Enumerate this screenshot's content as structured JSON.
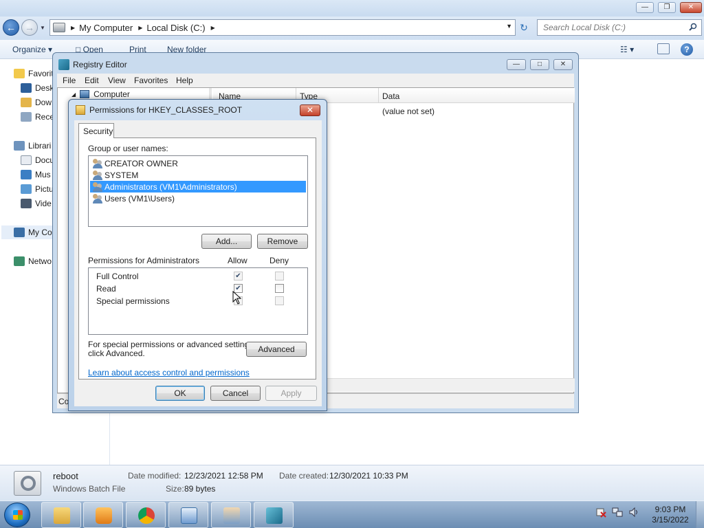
{
  "explorer": {
    "address": [
      "My Computer",
      "Local Disk (C:)"
    ],
    "search_placeholder": "Search Local Disk (C:)",
    "toolbar": {
      "organize": "Organize",
      "open": "Open",
      "print": "Print",
      "new_folder": "New folder"
    },
    "nav": {
      "favorites": "Favorit",
      "desktop": "Desk",
      "downloads": "Dow",
      "recent": "Rece",
      "libraries": "Librari",
      "documents": "Docu",
      "music": "Mus",
      "pictures": "Pictu",
      "videos": "Vide",
      "my_computer": "My Co",
      "network": "Netwo"
    },
    "details": {
      "name": "reboot",
      "type": "Windows Batch File",
      "date_modified_label": "Date modified:",
      "date_modified": "12/23/2021 12:58 PM",
      "date_created_label": "Date created:",
      "date_created": "12/30/2021 10:33 PM",
      "size_label": "Size:",
      "size": "89 bytes"
    }
  },
  "regedit": {
    "title": "Registry Editor",
    "menu": [
      "File",
      "Edit",
      "View",
      "Favorites",
      "Help"
    ],
    "tree_root": "Computer",
    "columns": {
      "name": "Name",
      "type": "Type",
      "data": "Data"
    },
    "row_data": "(value not set)",
    "status": "Co"
  },
  "permissions": {
    "title": "Permissions for HKEY_CLASSES_ROOT",
    "tab": "Security",
    "group_label": "Group or user names:",
    "users": [
      "CREATOR OWNER",
      "SYSTEM",
      "Administrators (VM1\\Administrators)",
      "Users (VM1\\Users)"
    ],
    "selected_user_index": 2,
    "add_button": "Add...",
    "remove_button": "Remove",
    "perm_for_label": "Permissions for Administrators",
    "allow_label": "Allow",
    "deny_label": "Deny",
    "perms": [
      {
        "name": "Full Control",
        "allow": true,
        "deny": false
      },
      {
        "name": "Read",
        "allow": true,
        "deny": false
      },
      {
        "name": "Special permissions",
        "allow": false,
        "deny": false
      }
    ],
    "special_text_1": "For special permissions or advanced settings,",
    "special_text_2": "click Advanced.",
    "advanced_button": "Advanced",
    "learn_link": "Learn about access control and permissions",
    "ok": "OK",
    "cancel": "Cancel",
    "apply": "Apply"
  },
  "taskbar": {
    "time": "9:03 PM",
    "date": "3/15/2022",
    "apps": [
      "explorer-icon",
      "media-player-icon",
      "chrome-icon",
      "control-panel-icon",
      "users-icon",
      "regedit-icon"
    ]
  },
  "colors": {
    "selection": "#3399ff",
    "link": "#0066cc"
  }
}
